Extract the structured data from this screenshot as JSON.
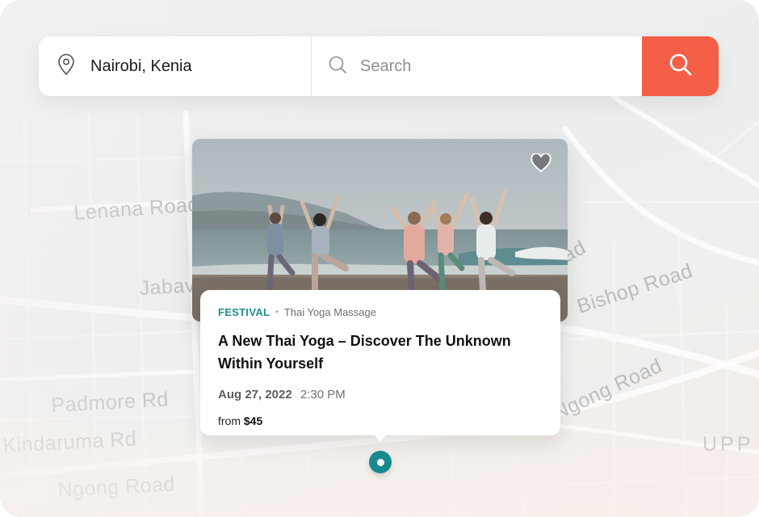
{
  "search": {
    "location_value": "Nairobi, Kenia",
    "query_placeholder": "Search"
  },
  "map": {
    "labels": [
      "Lenana Road",
      "Jabavu",
      "Padmore Rd",
      "Kindaruma Rd",
      "Ngong Road",
      "ad",
      "Bishop Road",
      "Ngong Road",
      "UPP"
    ]
  },
  "event_card": {
    "category": "FESTIVAL",
    "separator": "•",
    "subcategory": "Thai Yoga Massage",
    "title": "A New Thai Yoga – Discover The Unknown Within Yourself",
    "date": "Aug 27, 2022",
    "time": "2:30 PM",
    "price_prefix": "from",
    "price": "$45",
    "favorite": false
  },
  "colors": {
    "accent": "#f35f47",
    "category": "#1f8f8c",
    "pin": "#168a8f"
  },
  "icons": [
    "location-pin-icon",
    "search-icon",
    "heart-icon",
    "map-marker-icon"
  ]
}
